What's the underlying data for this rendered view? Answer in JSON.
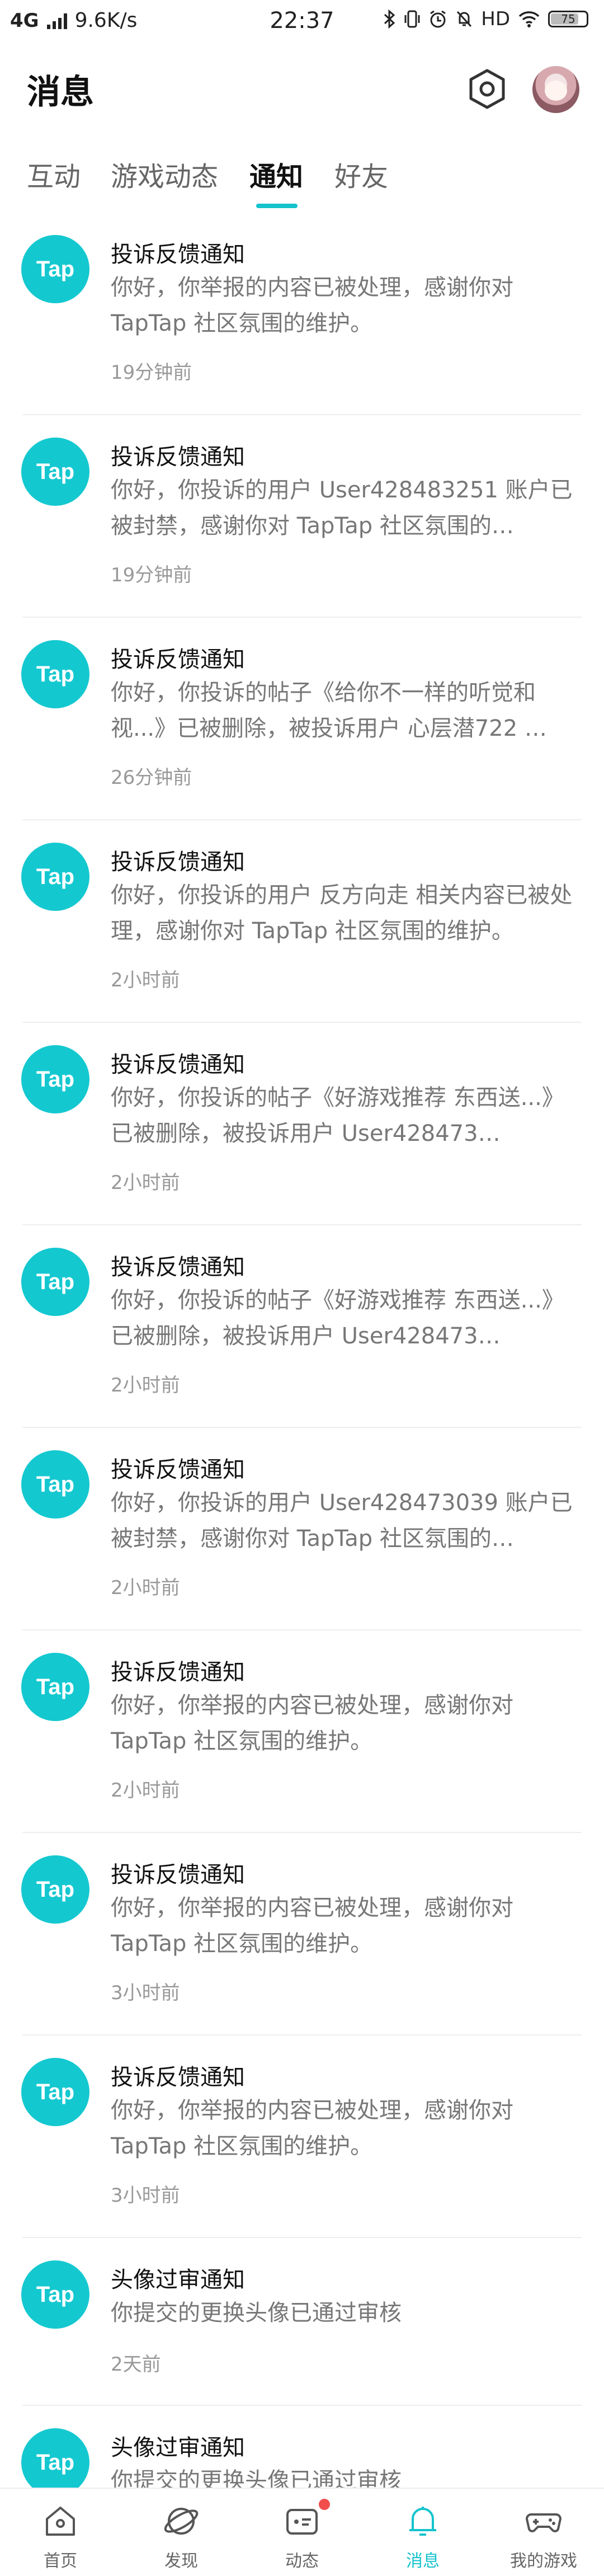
{
  "status_bar": {
    "network": "4G",
    "speed": "9.6K/s",
    "time": "22:37",
    "hd": "HD",
    "battery": "75"
  },
  "header": {
    "title": "消息"
  },
  "tabs": [
    {
      "label": "互动",
      "active": false
    },
    {
      "label": "游戏动态",
      "active": false
    },
    {
      "label": "通知",
      "active": true
    },
    {
      "label": "好友",
      "active": false
    }
  ],
  "logo_text": "Tap",
  "notifications": [
    {
      "title": "投诉反馈通知",
      "body": "你好，你举报的内容已被处理，感谢你对 TapTap 社区氛围的维护。",
      "time": "19分钟前"
    },
    {
      "title": "投诉反馈通知",
      "body": "你好，你投诉的用户 User428483251 账户已被封禁，感谢你对 TapTap 社区氛围的…",
      "time": "19分钟前"
    },
    {
      "title": "投诉反馈通知",
      "body": "你好，你投诉的帖子《给你不一样的听觉和视...》已被删除，被投诉用户 心层潜722 …",
      "time": "26分钟前"
    },
    {
      "title": "投诉反馈通知",
      "body": "你好，你投诉的用户 反方向走 相关内容已被处理，感谢你对 TapTap 社区氛围的维护。",
      "time": "2小时前"
    },
    {
      "title": "投诉反馈通知",
      "body": "你好，你投诉的帖子《好游戏推荐 东西送...》已被删除，被投诉用户 User428473…",
      "time": "2小时前"
    },
    {
      "title": "投诉反馈通知",
      "body": "你好，你投诉的帖子《好游戏推荐 东西送...》已被删除，被投诉用户 User428473…",
      "time": "2小时前"
    },
    {
      "title": "投诉反馈通知",
      "body": "你好，你投诉的用户 User428473039 账户已被封禁，感谢你对 TapTap 社区氛围的…",
      "time": "2小时前"
    },
    {
      "title": "投诉反馈通知",
      "body": "你好，你举报的内容已被处理，感谢你对 TapTap 社区氛围的维护。",
      "time": "2小时前"
    },
    {
      "title": "投诉反馈通知",
      "body": "你好，你举报的内容已被处理，感谢你对 TapTap 社区氛围的维护。",
      "time": "3小时前"
    },
    {
      "title": "投诉反馈通知",
      "body": "你好，你举报的内容已被处理，感谢你对 TapTap 社区氛围的维护。",
      "time": "3小时前"
    },
    {
      "title": "头像过审通知",
      "body": "你提交的更换头像已通过审核",
      "time": "2天前"
    },
    {
      "title": "头像过审通知",
      "body": "你提交的更换头像已通过审核",
      "time": ""
    }
  ],
  "bottom_nav": [
    {
      "label": "首页",
      "icon": "home-icon",
      "active": false
    },
    {
      "label": "发现",
      "icon": "discover-icon",
      "active": false
    },
    {
      "label": "动态",
      "icon": "feed-icon",
      "active": false,
      "badge": true
    },
    {
      "label": "消息",
      "icon": "bell-icon",
      "active": true
    },
    {
      "label": "我的游戏",
      "icon": "gamepad-icon",
      "active": false
    }
  ],
  "colors": {
    "accent": "#14c3cc",
    "badge": "#f24d4d"
  }
}
